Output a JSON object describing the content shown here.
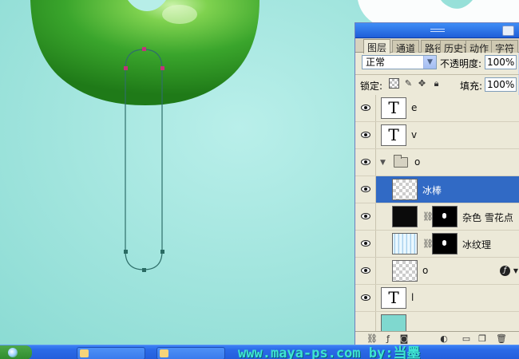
{
  "panel": {
    "tabs": [
      "图层",
      "通道",
      "路径",
      "历史记录",
      "动作",
      "字符"
    ],
    "blend_mode": "正常",
    "opacity_label": "不透明度:",
    "opacity_value": "100%",
    "lock_label": "锁定:",
    "fill_label": "填充:",
    "fill_value": "100%"
  },
  "layers": [
    {
      "name": "e",
      "kind": "text",
      "thumb": "T",
      "selected": false
    },
    {
      "name": "v",
      "kind": "text",
      "thumb": "T",
      "selected": false
    },
    {
      "name": "o",
      "kind": "group",
      "selected": false
    },
    {
      "name": "冰棒",
      "kind": "pixel",
      "selected": true
    },
    {
      "name": "杂色 雪花点",
      "kind": "masked",
      "selected": false
    },
    {
      "name": "冰纹理",
      "kind": "masked",
      "selected": false
    },
    {
      "name": "o",
      "kind": "pixel-fx",
      "selected": false
    },
    {
      "name": "l",
      "kind": "text",
      "thumb": "T",
      "selected": false
    }
  ],
  "watermark": "www.maya-ps.com  by:当墨",
  "colors": {
    "canvas_bg": "#a2e5de",
    "donut_green": "#3aa52c",
    "path_stroke": "#2f6f6a",
    "anchor_pink": "#c2337a",
    "anchor_teal": "#2a6b63",
    "selection_blue": "#316ac5",
    "taskbar_blue": "#245edb"
  },
  "icons": {
    "eye": "eye-icon",
    "link": "chain-link-icon",
    "fx": "fx-icon",
    "folder": "folder-icon",
    "lock_transparency": "lock-transparency-icon",
    "lock_brush": "brush-icon",
    "lock_move": "move-icon",
    "lock_all": "padlock-icon",
    "close": "close-icon",
    "start": "start-orb-icon"
  }
}
